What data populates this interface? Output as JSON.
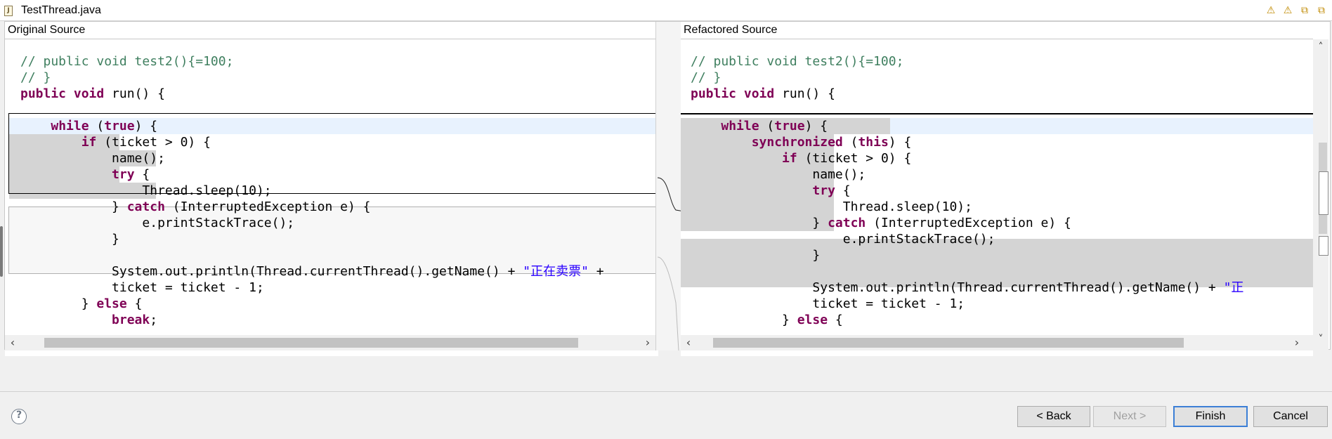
{
  "file_tab": {
    "name": "TestThread.java",
    "icon": "J"
  },
  "toolbar_icons": [
    "warning-up-icon",
    "warning-down-icon",
    "copy-left-icon",
    "copy-right-icon"
  ],
  "left_pane": {
    "title": "Original Source",
    "lines": [
      [
        [
          "cm",
          "// public void test2(){=100;"
        ]
      ],
      [
        [
          "cm",
          "// }"
        ]
      ],
      [
        [
          "kw",
          "public"
        ],
        [
          "tx",
          " "
        ],
        [
          "kw",
          "void"
        ],
        [
          "tx",
          " run() {"
        ]
      ],
      [
        [
          "tx",
          ""
        ]
      ],
      [
        [
          "tx",
          "    "
        ],
        [
          "kw",
          "while"
        ],
        [
          "tx",
          " ("
        ],
        [
          "kw",
          "true"
        ],
        [
          "tx",
          ") {"
        ]
      ],
      [
        [
          "tx",
          "        "
        ],
        [
          "kw",
          "if"
        ],
        [
          "tx",
          " (ticket > 0) {"
        ]
      ],
      [
        [
          "tx",
          "            name();"
        ]
      ],
      [
        [
          "tx",
          "            "
        ],
        [
          "kw",
          "try"
        ],
        [
          "tx",
          " {"
        ]
      ],
      [
        [
          "tx",
          "                Thread.sleep(10);"
        ]
      ],
      [
        [
          "tx",
          "            } "
        ],
        [
          "kw",
          "catch"
        ],
        [
          "tx",
          " (InterruptedException e) {"
        ]
      ],
      [
        [
          "tx",
          "                e.printStackTrace();"
        ]
      ],
      [
        [
          "tx",
          "            }"
        ]
      ],
      [
        [
          "tx",
          ""
        ]
      ],
      [
        [
          "tx",
          "            System.out.println(Thread.currentThread().getName() + "
        ],
        [
          "st",
          "\"正在卖票\""
        ],
        [
          "tx",
          " +"
        ]
      ],
      [
        [
          "tx",
          "            ticket = ticket - 1;"
        ]
      ],
      [
        [
          "tx",
          "        } "
        ],
        [
          "kw",
          "else"
        ],
        [
          "tx",
          " {"
        ]
      ],
      [
        [
          "tx",
          "            "
        ],
        [
          "kw",
          "break"
        ],
        [
          "tx",
          ";"
        ]
      ]
    ]
  },
  "right_pane": {
    "title": "Refactored Source",
    "lines": [
      [
        [
          "cm",
          "// public void test2(){=100;"
        ]
      ],
      [
        [
          "cm",
          "// }"
        ]
      ],
      [
        [
          "kw",
          "public"
        ],
        [
          "tx",
          " "
        ],
        [
          "kw",
          "void"
        ],
        [
          "tx",
          " run() {"
        ]
      ],
      [
        [
          "tx",
          ""
        ]
      ],
      [
        [
          "tx",
          "    "
        ],
        [
          "kw",
          "while"
        ],
        [
          "tx",
          " ("
        ],
        [
          "kw",
          "true"
        ],
        [
          "tx",
          ") {"
        ]
      ],
      [
        [
          "tx",
          "        "
        ],
        [
          "kw",
          "synchronized"
        ],
        [
          "tx",
          " ("
        ],
        [
          "kw",
          "this"
        ],
        [
          "tx",
          ") {"
        ]
      ],
      [
        [
          "tx",
          "            "
        ],
        [
          "kw",
          "if"
        ],
        [
          "tx",
          " (ticket > 0) {"
        ]
      ],
      [
        [
          "tx",
          "                name();"
        ]
      ],
      [
        [
          "tx",
          "                "
        ],
        [
          "kw",
          "try"
        ],
        [
          "tx",
          " {"
        ]
      ],
      [
        [
          "tx",
          "                    Thread.sleep(10);"
        ]
      ],
      [
        [
          "tx",
          "                } "
        ],
        [
          "kw",
          "catch"
        ],
        [
          "tx",
          " (InterruptedException e) {"
        ]
      ],
      [
        [
          "tx",
          "                    e.printStackTrace();"
        ]
      ],
      [
        [
          "tx",
          "                }"
        ]
      ],
      [
        [
          "tx",
          ""
        ]
      ],
      [
        [
          "tx",
          "                System.out.println(Thread.currentThread().getName() + "
        ],
        [
          "st",
          "\"正"
        ]
      ],
      [
        [
          "tx",
          "                ticket = ticket - 1;"
        ]
      ],
      [
        [
          "tx",
          "            } "
        ],
        [
          "kw",
          "else"
        ],
        [
          "tx",
          " {"
        ]
      ]
    ]
  },
  "buttons": {
    "back": "< Back",
    "next": "Next >",
    "finish": "Finish",
    "cancel": "Cancel"
  },
  "colors": {
    "keyword": "#7f0055",
    "comment": "#3f7f5f",
    "string": "#2a00ff",
    "diff_gray": "#d4d4d4",
    "current_line": "#e8f2fe"
  }
}
